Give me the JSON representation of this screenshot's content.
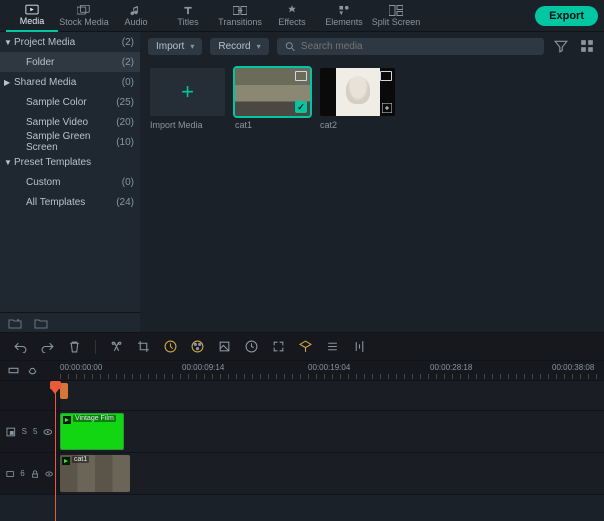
{
  "tabs": {
    "media": "Media",
    "stock": "Stock Media",
    "audio": "Audio",
    "titles": "Titles",
    "transitions": "Transitions",
    "effects": "Effects",
    "elements": "Elements",
    "split": "Split Screen"
  },
  "export": "Export",
  "sidebar": {
    "project_media": {
      "label": "Project Media",
      "count": "(2)"
    },
    "folder": {
      "label": "Folder",
      "count": "(2)"
    },
    "shared_media": {
      "label": "Shared Media",
      "count": "(0)"
    },
    "sample_color": {
      "label": "Sample Color",
      "count": "(25)"
    },
    "sample_video": {
      "label": "Sample Video",
      "count": "(20)"
    },
    "sample_green": {
      "label": "Sample Green Screen",
      "count": "(10)"
    },
    "preset_templates": {
      "label": "Preset Templates",
      "count": ""
    },
    "custom": {
      "label": "Custom",
      "count": "(0)"
    },
    "all_templates": {
      "label": "All Templates",
      "count": "(24)"
    }
  },
  "content": {
    "import": "Import",
    "record": "Record",
    "search_placeholder": "Search media"
  },
  "thumbs": {
    "import_media": "Import Media",
    "cat1": "cat1",
    "cat2": "cat2"
  },
  "ruler": {
    "t0": "00:00:00:00",
    "t1": "00:00:09:14",
    "t2": "00:00:19:04",
    "t3": "00:00:28:18",
    "t4": "00:00:38:08"
  },
  "clips": {
    "green_label": "Vintage Film",
    "video_label": "cat1"
  },
  "track": {
    "s": "S",
    "n5": "5",
    "n6": "6"
  }
}
